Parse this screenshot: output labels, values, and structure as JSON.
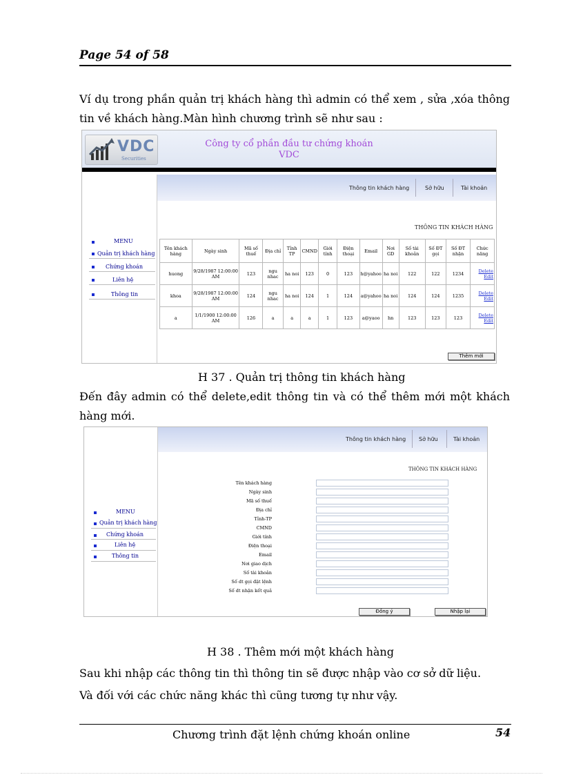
{
  "page": {
    "header": "Page 54 of 58",
    "intro": "Ví dụ trong phần quản trị khách hàng thì admin có thể xem , sửa ,xóa thông tin về khách hàng.Màn hình chương trình sẽ như sau :",
    "caption1": "H 37 . Quản trị thông tin khách hàng",
    "middle": "Đến đây admin có thể delete,edit thông tin và có thể thêm mới một khách hàng mới.",
    "caption2": "H 38 . Thêm mới một khách hàng",
    "after1": "Sau khi nhập các thông tin thì thông tin sẽ được nhập vào cơ sở dữ liệu.",
    "after2": "Và đối với các chức năng khác thì cũng tương tự như vậy.",
    "footer_title": "Chương trình đặt lệnh chứng khoán online",
    "footer_page": "54"
  },
  "app": {
    "logo": "VDC",
    "logo_sub": "Securities",
    "company_line1": "Công ty cổ phần đầu tư chứng khoán",
    "company_line2": "VDC",
    "nav": [
      "Thông tin khách hàng",
      "Sở hữu",
      "Tài khoản"
    ],
    "menu": [
      "MENU",
      "Quản trị khách hàng",
      "Chứng khoán",
      "Liên hệ",
      "Thông tin"
    ],
    "section_title": "THÔNG TIN KHÁCH HÀNG",
    "add_button": "Thêm mới"
  },
  "table": {
    "columns": [
      "Tên khách hàng",
      "Ngày sinh",
      "Mã số thuế",
      "Địa chỉ",
      "Tỉnh TP",
      "CMND",
      "Giới tính",
      "Điện thoại",
      "Email",
      "Nơi GD",
      "Số tài khoản",
      "Số ĐT gọi",
      "Số ĐT nhận",
      "Chức năng"
    ],
    "rows": [
      [
        "huong",
        "9/28/1987 12:00:00 AM",
        "123",
        "ngu nhac",
        "ha noi",
        "123",
        "0",
        "123",
        "h@yahoo",
        "ha noi",
        "122",
        "122",
        "1234"
      ],
      [
        "khoa",
        "9/28/1987 12:00:00 AM",
        "124",
        "ngu nhac",
        "ha noi",
        "124",
        "1",
        "124",
        "a@yahoo",
        "ha noi",
        "124",
        "124",
        "1235"
      ],
      [
        "a",
        "1/1/1900 12:00:00 AM",
        "126",
        "a",
        "a",
        "a",
        "1",
        "123",
        "a@yaoo",
        "hn",
        "123",
        "123",
        "123"
      ]
    ],
    "actions": [
      "Delete",
      "Edit"
    ]
  },
  "form": {
    "fields": [
      "Tên khách hàng",
      "Ngày sinh",
      "Mã số thuế",
      "Địa chỉ",
      "Tỉnh-TP",
      "CMND",
      "Giới tính",
      "Điện thoại",
      "Email",
      "Nơi giao dịch",
      "Số tài khoản",
      "Số dt gọi đặt lệnh",
      "Số dt nhận kết quả"
    ],
    "submit": "Đồng ý",
    "reset": "Nhập lại"
  }
}
